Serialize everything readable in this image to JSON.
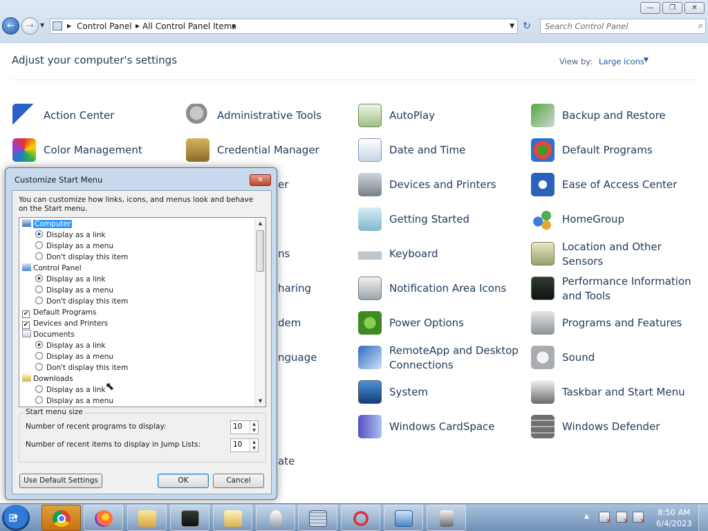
{
  "window": {
    "minimize_icon": "minimize-icon",
    "maximize_icon": "restore-icon",
    "close_icon": "close-icon",
    "min_glyph": "—",
    "max_glyph": "❐",
    "close_glyph": "✕"
  },
  "nav": {
    "back_glyph": "←",
    "forward_glyph": "→",
    "history_glyph": "▼",
    "breadcrumbs": [
      "Control Panel",
      "All Control Panel Items"
    ],
    "separator": "▶",
    "dropdown_glyph": "▼",
    "refresh_glyph": "↻"
  },
  "search": {
    "placeholder": "Search Control Panel",
    "icon": "search-icon",
    "glyph": "⌕"
  },
  "header": {
    "title": "Adjust your computer's settings",
    "view_by_label": "View by:",
    "view_by_value": "Large icons",
    "view_by_arrow": "▼"
  },
  "items": [
    {
      "label": "Action Center",
      "icon": "flag-icon"
    },
    {
      "label": "Administrative Tools",
      "icon": "admin-tools-icon"
    },
    {
      "label": "AutoPlay",
      "icon": "autoplay-icon"
    },
    {
      "label": "Backup and Restore",
      "icon": "backup-icon"
    },
    {
      "label": "Color Management",
      "icon": "color-management-icon"
    },
    {
      "label": "Credential Manager",
      "icon": "credential-icon"
    },
    {
      "label": "Date and Time",
      "icon": "calendar-icon"
    },
    {
      "label": "Default Programs",
      "icon": "default-programs-icon"
    },
    {
      "label": "er",
      "icon": ""
    },
    {
      "label": "Devices and Printers",
      "icon": "printer-icon"
    },
    {
      "label": "Ease of Access Center",
      "icon": "ease-of-access-icon"
    },
    {
      "label": "Getting Started",
      "icon": "getting-started-icon"
    },
    {
      "label": "HomeGroup",
      "icon": "homegroup-icon"
    },
    {
      "label": "ns",
      "icon": ""
    },
    {
      "label": "Keyboard",
      "icon": "keyboard-icon"
    },
    {
      "label": "Location and Other Sensors",
      "label_line1": "Location and Other",
      "label_line2": "Sensors",
      "icon": "location-icon"
    },
    {
      "label": "haring",
      "icon": ""
    },
    {
      "label": "Notification Area Icons",
      "icon": "notification-icon"
    },
    {
      "label": "Performance Information and Tools",
      "label_line1": "Performance Information",
      "label_line2": "and Tools",
      "icon": "performance-icon"
    },
    {
      "label": "dem",
      "icon": ""
    },
    {
      "label": "Power Options",
      "icon": "power-icon"
    },
    {
      "label": "Programs and Features",
      "icon": "programs-icon"
    },
    {
      "label": "nguage",
      "icon": ""
    },
    {
      "label": "RemoteApp and Desktop Connections",
      "label_line1": "RemoteApp and Desktop",
      "label_line2": "Connections",
      "icon": "remoteapp-icon"
    },
    {
      "label": "Sound",
      "icon": "speaker-icon"
    },
    {
      "label": "System",
      "icon": "system-icon"
    },
    {
      "label": "Taskbar and Start Menu",
      "icon": "taskbar-icon"
    },
    {
      "label": "Windows CardSpace",
      "icon": "cardspace-icon"
    },
    {
      "label": "Windows Defender",
      "icon": "defender-icon"
    },
    {
      "label": "ate",
      "icon": ""
    }
  ],
  "dialog": {
    "title": "Customize Start Menu",
    "close_glyph": "✕",
    "description": "You can customize how links, icons, and menus look and behave on the Start menu.",
    "options": [
      {
        "type": "group",
        "label": "Computer",
        "icon": "computer-icon",
        "selected": true
      },
      {
        "type": "radio",
        "label": "Display as a link",
        "checked": true
      },
      {
        "type": "radio",
        "label": "Display as a menu",
        "checked": false
      },
      {
        "type": "radio",
        "label": "Don't display this item",
        "checked": false
      },
      {
        "type": "group",
        "label": "Control Panel",
        "icon": "control-panel-icon",
        "selected": false
      },
      {
        "type": "radio",
        "label": "Display as a link",
        "checked": true
      },
      {
        "type": "radio",
        "label": "Display as a menu",
        "checked": false
      },
      {
        "type": "radio",
        "label": "Don't display this item",
        "checked": false
      },
      {
        "type": "check",
        "label": "Default Programs",
        "checked": true
      },
      {
        "type": "check",
        "label": "Devices and Printers",
        "checked": true
      },
      {
        "type": "group",
        "label": "Documents",
        "icon": "documents-icon",
        "selected": false
      },
      {
        "type": "radio",
        "label": "Display as a link",
        "checked": true
      },
      {
        "type": "radio",
        "label": "Display as a menu",
        "checked": false
      },
      {
        "type": "radio",
        "label": "Don't display this item",
        "checked": false
      },
      {
        "type": "group",
        "label": "Downloads",
        "icon": "downloads-icon",
        "selected": false
      },
      {
        "type": "radio",
        "label": "Display as a link",
        "checked": false
      },
      {
        "type": "radio",
        "label": "Display as a menu",
        "checked": false
      }
    ],
    "check_glyph": "✔",
    "scroll_up_glyph": "▲",
    "scroll_down_glyph": "▼",
    "size_title": "Start menu size",
    "recent_programs_label": "Number of recent programs to display:",
    "recent_programs_value": "10",
    "recent_items_label": "Number of recent items to display in Jump Lists:",
    "recent_items_value": "10",
    "spin_up": "▲",
    "spin_down": "▼",
    "default_button": "Use Default Settings",
    "ok_button": "OK",
    "cancel_button": "Cancel"
  },
  "cursor_glyph": "⬉",
  "taskbar": {
    "start_glyph": "⊞",
    "apps": [
      "chrome",
      "firefox",
      "windows-explorer",
      "performance-monitor",
      "folder-options",
      "mouse",
      "calculator",
      "snipping-tool",
      "control-panel",
      "taskbar-properties"
    ],
    "tray_arrow": "▲",
    "clock_time": "8:50 AM",
    "clock_date": "6/4/2023"
  }
}
